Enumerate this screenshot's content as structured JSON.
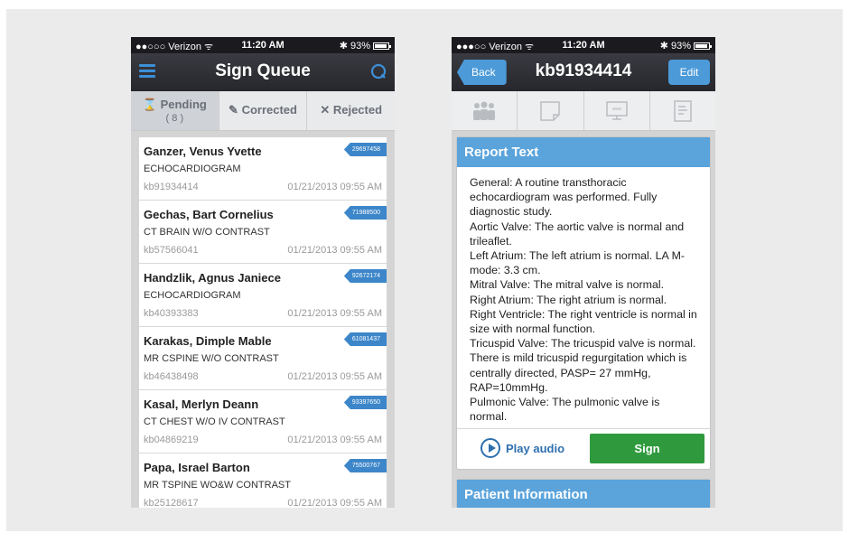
{
  "status_bar_left": {
    "carrier": "●●○○○ Verizon ᯤ",
    "time": "11:20 AM",
    "battery": "93%"
  },
  "status_bar_right": {
    "carrier": "●●●○○ Verizon ᯤ",
    "time": "11:20 AM",
    "battery": "93%"
  },
  "sign_queue": {
    "title": "Sign Queue",
    "tabs": [
      {
        "label": "Pending",
        "count": "( 8 )",
        "icon": "hourglass-icon"
      },
      {
        "label": "Corrected",
        "icon": "pencil-check-icon"
      },
      {
        "label": "Rejected",
        "icon": "x-icon"
      }
    ],
    "items": [
      {
        "name": "Ganzer, Venus Yvette",
        "procedure": "ECHOCARDIOGRAM",
        "accession": "kb91934414",
        "date": "01/21/2013 09:55 AM",
        "tag": "29697458"
      },
      {
        "name": "Gechas, Bart Cornelius",
        "procedure": "CT BRAIN W/O CONTRAST",
        "accession": "kb57566041",
        "date": "01/21/2013 09:55 AM",
        "tag": "71988500"
      },
      {
        "name": "Handzlik, Agnus Janiece",
        "procedure": "ECHOCARDIOGRAM",
        "accession": "kb40393383",
        "date": "01/21/2013 09:55 AM",
        "tag": "92672174"
      },
      {
        "name": "Karakas, Dimple Mable",
        "procedure": "MR CSPINE W/O CONTRAST",
        "accession": "kb46438498",
        "date": "01/21/2013 09:55 AM",
        "tag": "61081437"
      },
      {
        "name": "Kasal, Merlyn Deann",
        "procedure": "CT CHEST W/O IV CONTRAST",
        "accession": "kb04869219",
        "date": "01/21/2013 09:55 AM",
        "tag": "93397650"
      },
      {
        "name": "Papa, Israel Barton",
        "procedure": "MR TSPINE WO&W CONTRAST",
        "accession": "kb25128617",
        "date": "01/21/2013 09:55 AM",
        "tag": "75500767"
      }
    ]
  },
  "report": {
    "back_label": "Back",
    "title": "kb91934414",
    "edit_label": "Edit",
    "icons": [
      "patients-icon",
      "note-icon",
      "monitor-icon",
      "document-icon"
    ],
    "section_title": "Report Text",
    "lines": [
      "General: A routine transthoracic echocardiogram was performed. Fully diagnostic study.",
      "Aortic Valve: The aortic valve is normal and trileaflet.",
      "Left Atrium: The left atrium is normal. LA M-mode: 3.3 cm.",
      "Mitral Valve: The mitral valve is normal.",
      "Right Atrium: The right atrium is normal.",
      "Right Ventricle: The right ventricle is normal in size with normal function.",
      "Tricuspid Valve: The tricuspid valve is normal. There is mild tricuspid regurgitation which is centrally directed, PASP= 27 mmHg,",
      "RAP=10mmHg.",
      "Pulmonic Valve: The pulmonic valve is normal."
    ],
    "play_label": "Play audio",
    "sign_label": "Sign",
    "patient_section_title": "Patient Information"
  }
}
